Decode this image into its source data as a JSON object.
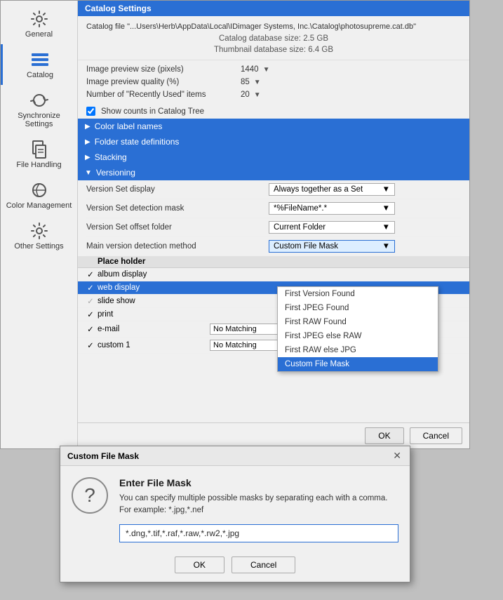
{
  "sidebar": {
    "items": [
      {
        "id": "general",
        "label": "General",
        "active": false
      },
      {
        "id": "catalog",
        "label": "Catalog",
        "active": true
      },
      {
        "id": "synchronize",
        "label": "Synchronize Settings",
        "active": false
      },
      {
        "id": "file-handling",
        "label": "File Handling",
        "active": false
      },
      {
        "id": "color-management",
        "label": "Color Management",
        "active": false
      },
      {
        "id": "other-settings",
        "label": "Other Settings",
        "active": false
      }
    ]
  },
  "title_bar": {
    "label": "Catalog Settings"
  },
  "catalog_file": {
    "label": "Catalog file \"...Users\\Herb\\AppData\\Local\\IDimager Systems, Inc.\\Catalog\\photosupreme.cat.db\""
  },
  "catalog_db_size": {
    "label": "Catalog database size: 2.5 GB"
  },
  "thumbnail_db_size": {
    "label": "Thumbnail database size: 6.4 GB"
  },
  "settings": {
    "image_preview_size_label": "Image preview size (pixels)",
    "image_preview_size_value": "1440",
    "image_preview_quality_label": "Image preview quality (%)",
    "image_preview_quality_value": "85",
    "recently_used_label": "Number of \"Recently Used\" items",
    "recently_used_value": "20",
    "show_counts_label": "Show counts in Catalog Tree"
  },
  "sections": {
    "color_label": "Color label names",
    "folder_state": "Folder state definitions",
    "stacking": "Stacking",
    "versioning": "Versioning"
  },
  "versioning": {
    "version_set_display_label": "Version Set display",
    "version_set_display_value": "Always together as a Set",
    "version_set_mask_label": "Version Set detection mask",
    "version_set_mask_value": "*%FileName*.*",
    "version_offset_label": "Version Set offset folder",
    "version_offset_value": "Current Folder",
    "main_version_label": "Main version detection method",
    "main_version_value": "Custom File Mask"
  },
  "placeholder_table": {
    "header": "Place holder",
    "rows": [
      {
        "checked": true,
        "label": "album display",
        "selected": false,
        "match": ""
      },
      {
        "checked": true,
        "label": "web display",
        "selected": true,
        "match": ""
      },
      {
        "checked": true,
        "label": "slide show",
        "selected": false,
        "match": ""
      },
      {
        "checked": true,
        "label": "print",
        "selected": false,
        "match": ""
      },
      {
        "checked": true,
        "label": "e-mail",
        "selected": false,
        "match": "No Matching"
      },
      {
        "checked": true,
        "label": "custom 1",
        "selected": false,
        "match": "No Matching"
      }
    ]
  },
  "buttons": {
    "ok_label": "OK",
    "cancel_label": "Cancel"
  },
  "dropdown_options": [
    {
      "label": "First Version Found",
      "selected": false
    },
    {
      "label": "First JPEG Found",
      "selected": false
    },
    {
      "label": "First RAW Found",
      "selected": false
    },
    {
      "label": "First JPEG else RAW",
      "selected": false
    },
    {
      "label": "First RAW else JPG",
      "selected": false
    },
    {
      "label": "Custom File Mask",
      "selected": true
    }
  ],
  "dialog": {
    "title": "Custom File Mask",
    "heading": "Enter File Mask",
    "description": "You can specify multiple possible masks by separating each with a comma. For example: *.jpg,*.nef",
    "input_value": "*.dng,*.tif,*.raf,*.raw,*.rw2,*.jpg",
    "ok_label": "OK",
    "cancel_label": "Cancel"
  }
}
